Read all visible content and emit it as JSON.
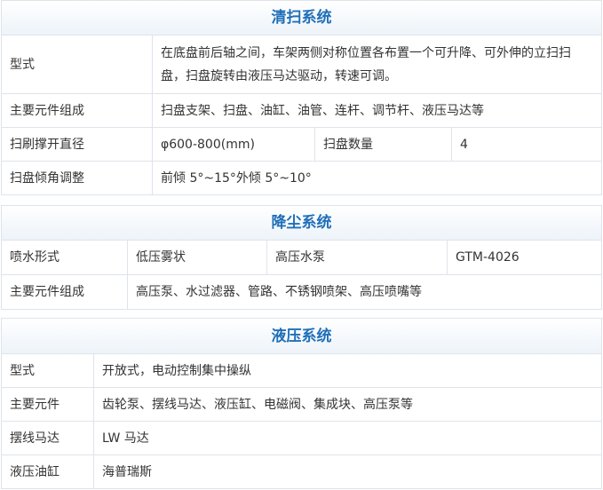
{
  "cleaning": {
    "title": "清扫系统",
    "rows": {
      "type_label": "型式",
      "type_value": "在底盘前后轴之间，车架两侧对称位置各布置一个可升降、可外伸的立扫扫盘，扫盘旋转由液压马达驱动，转速可调。",
      "components_label": "主要元件组成",
      "components_value": "扫盘支架、扫盘、油缸、油管、连杆、调节杆、液压马达等",
      "diameter_label": "扫刷撑开直径",
      "diameter_value": "φ600-800(mm)",
      "count_label": "扫盘数量",
      "count_value": "4",
      "tilt_label": "扫盘倾角调整",
      "tilt_value": "前倾 5°~15°外倾 5°~10°"
    }
  },
  "dust": {
    "title": "降尘系统",
    "rows": {
      "spray_label": "喷水形式",
      "spray_value": "低压雾状",
      "pump_label": "高压水泵",
      "pump_value": "GTM-4026",
      "components_label": "主要元件组成",
      "components_value": "高压泵、水过滤器、管路、不锈钢喷架、高压喷嘴等"
    }
  },
  "hydraulic": {
    "title": "液压系统",
    "rows": {
      "type_label": "型式",
      "type_value": "开放式，电动控制集中操纵",
      "components_label": "主要元件",
      "components_value": "齿轮泵、摆线马达、液压缸、电磁阀、集成块、高压泵等",
      "motor_label": "摆线马达",
      "motor_value": "LW 马达",
      "cylinder_label": "液压油缸",
      "cylinder_value": "海普瑞斯"
    }
  }
}
